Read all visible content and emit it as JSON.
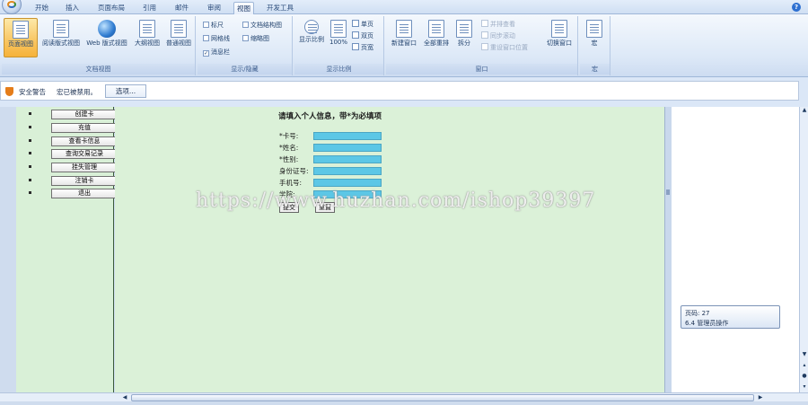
{
  "tabs": [
    {
      "label": "开始",
      "active": false
    },
    {
      "label": "插入",
      "active": false
    },
    {
      "label": "页面布局",
      "active": false
    },
    {
      "label": "引用",
      "active": false
    },
    {
      "label": "邮件",
      "active": false
    },
    {
      "label": "审阅",
      "active": false
    },
    {
      "label": "视图",
      "active": true
    },
    {
      "label": "开发工具",
      "active": false
    }
  ],
  "ribbon": {
    "doc_views": {
      "label": "文档视图",
      "buttons": [
        "页面视图",
        "阅读版式视图",
        "Web 版式视图",
        "大纲视图",
        "普通视图"
      ]
    },
    "show_hide": {
      "label": "显示/隐藏",
      "checks": [
        {
          "label": "标尺",
          "checked": false
        },
        {
          "label": "网格线",
          "checked": false
        },
        {
          "label": "消息栏",
          "checked": true
        },
        {
          "label": "文档结构图",
          "checked": false
        },
        {
          "label": "缩略图",
          "checked": false
        }
      ]
    },
    "zoom": {
      "label": "显示比例",
      "zoom_button": "显示比例",
      "percent_button": "100%",
      "small": [
        "单页",
        "双页",
        "页宽"
      ]
    },
    "window": {
      "label": "窗口",
      "buttons": [
        "新建窗口",
        "全部重排",
        "拆分"
      ],
      "small": [
        "并排查看",
        "同步滚动",
        "重设窗口位置"
      ],
      "switch": "切换窗口"
    },
    "macro": {
      "label": "宏",
      "button": "宏"
    }
  },
  "security": {
    "title": "安全警告",
    "message": "宏已被禁用。",
    "options_button": "选项..."
  },
  "nav": [
    "创建卡",
    "充值",
    "查看卡信息",
    "查询交易记录",
    "挂失管理",
    "注销卡",
    "退出"
  ],
  "form": {
    "title": "请填入个人信息，带*为必填项",
    "fields": [
      "*卡号:",
      "*姓名:",
      "*性别:",
      "身份证号:",
      "手机号:",
      "学院:"
    ],
    "submit": "提交",
    "reset": "重置"
  },
  "watermark": "https://www.huzhan.com/ishop39397",
  "status_tooltip": {
    "line1": "页码: 27",
    "line2": "6.4 管理员操作"
  },
  "colors": {
    "form_bg": "#dbf1d8",
    "input_fill": "#5cc7e6",
    "ribbon_selected": "#f8c561"
  }
}
